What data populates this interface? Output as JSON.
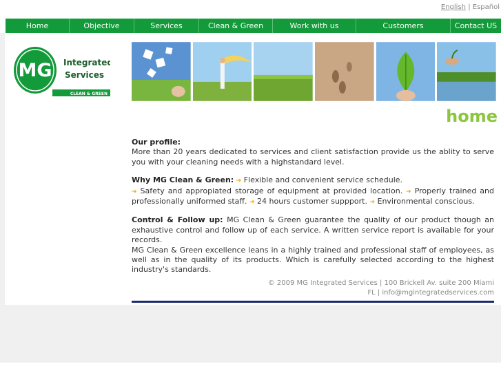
{
  "lang": {
    "english": "English",
    "separator": "|",
    "spanish": "Español"
  },
  "nav": [
    "Home",
    "Objective",
    "Services",
    "Clean & Green",
    "Work with us",
    "Customers",
    "Contact US"
  ],
  "logo": {
    "mark": "MG",
    "line1": "Integrated",
    "line2": "Services",
    "tag": "CLEAN & GREEN"
  },
  "photos": [
    "puzzle-sky",
    "woman-yellow-scarf",
    "green-field",
    "footprints-sand",
    "green-leaf",
    "sprout-hands-lake"
  ],
  "heading": "home",
  "profile": {
    "title": "Our profile:",
    "text": "More than 20 years dedicated to services and client satisfaction provide us the ablity to serve you with your cleaning needs with a highstandard level."
  },
  "why": {
    "title": "Why MG Clean & Green:",
    "items": [
      "Flexible and convenient service schedule.",
      "Safety and appropiated storage of equipment at provided location.",
      "Properly trained and professionally uniformed staff.",
      "24 hours customer suppport.",
      "Environmental conscious."
    ]
  },
  "control": {
    "title": "Control & Follow up:",
    "text": "MG Clean & Green guarantee the quality of our product though an exhaustive control and follow up of each service. A written service report is available for your records.",
    "text2": "MG Clean & Green excellence leans in a highly trained and professional staff of employees, as well as in the quality of its products. Which is carefully selected according to the highest industry's standards."
  },
  "footer": {
    "line1": "© 2009 MG Integrated Services  |  100 Brickell Av. suite 200 Miami",
    "line2": "FL  |   info@mgintegratedservices.com"
  },
  "colors": {
    "nav": "#139a3a",
    "heading": "#8cc63f",
    "rule": "#1b2a6b",
    "arrow": "#f7a800"
  }
}
